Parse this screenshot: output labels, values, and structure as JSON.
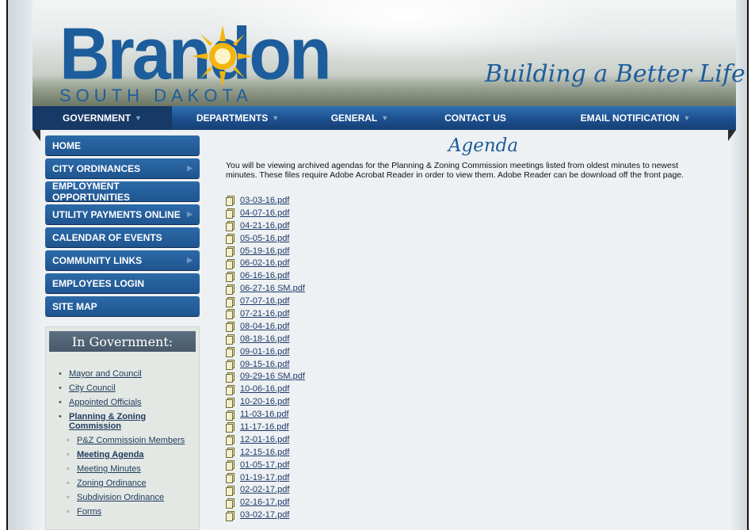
{
  "brand": {
    "name": "Brandon",
    "sub": "SOUTH DAKOTA",
    "tagline": "Building a Better Life"
  },
  "nav": [
    {
      "label": "GOVERNMENT",
      "active": true,
      "caret": true
    },
    {
      "label": "DEPARTMENTS",
      "caret": true
    },
    {
      "label": "GENERAL",
      "caret": true
    },
    {
      "label": "CONTACT US",
      "caret": false
    },
    {
      "label": "EMAIL NOTIFICATION",
      "caret": true
    }
  ],
  "sidebar": [
    {
      "label": "HOME",
      "arrow": false
    },
    {
      "label": "CITY ORDINANCES",
      "arrow": true
    },
    {
      "label": "EMPLOYMENT OPPORTUNITIES",
      "arrow": false
    },
    {
      "label": "UTILITY PAYMENTS ONLINE",
      "arrow": true
    },
    {
      "label": "CALENDAR OF EVENTS",
      "arrow": false
    },
    {
      "label": "COMMUNITY LINKS",
      "arrow": true
    },
    {
      "label": "EMPLOYEES LOGIN",
      "arrow": false
    },
    {
      "label": "SITE MAP",
      "arrow": false
    }
  ],
  "gov": {
    "title": "In Government:",
    "items": [
      {
        "label": "Mayor and Council",
        "bold": false,
        "sub": false
      },
      {
        "label": "City Council",
        "bold": false,
        "sub": false
      },
      {
        "label": "Appointed Officials",
        "bold": false,
        "sub": false
      },
      {
        "label": "Planning & Zoning Commission",
        "bold": true,
        "sub": false
      },
      {
        "label": "P&Z Commissioin Members",
        "bold": false,
        "sub": true
      },
      {
        "label": "Meeting Agenda",
        "bold": true,
        "sub": true
      },
      {
        "label": "Meeting Minutes",
        "bold": false,
        "sub": true
      },
      {
        "label": "Zoning Ordinance",
        "bold": false,
        "sub": true
      },
      {
        "label": "Subdivision Ordinance",
        "bold": false,
        "sub": true
      },
      {
        "label": "Forms",
        "bold": false,
        "sub": true
      }
    ]
  },
  "content": {
    "title": "Agenda",
    "intro": "You will be viewing archived agendas for the Planning & Zoning Commission meetings listed from oldest minutes to newest minutes.  These files require Adobe Acrobat Reader in order to view them.  Adobe Reader can be download off the front page.",
    "files": [
      "03-03-16.pdf",
      "04-07-16.pdf",
      "04-21-16.pdf",
      "05-05-16.pdf",
      "05-19-16.pdf",
      "06-02-16.pdf",
      "06-16-16.pdf",
      "06-27-16 SM.pdf",
      "07-07-16.pdf",
      "07-21-16.pdf",
      "08-04-16.pdf",
      "08-18-16.pdf",
      "09-01-16.pdf",
      "09-15-16.pdf",
      "09-29-16 SM.pdf",
      "10-06-16.pdf",
      "10-20-16.pdf",
      "11-03-16.pdf",
      "11-17-16.pdf",
      "12-01-16.pdf",
      "12-15-16.pdf",
      "01-05-17.pdf",
      "01-19-17.pdf",
      "02-02-17.pdf",
      "02-16-17.pdf",
      "03-02-17.pdf"
    ]
  },
  "colors": {
    "brand_blue": "#1d5d9b",
    "nav_blue": "#1d4f8e",
    "sun_yellow": "#f5b50a"
  }
}
